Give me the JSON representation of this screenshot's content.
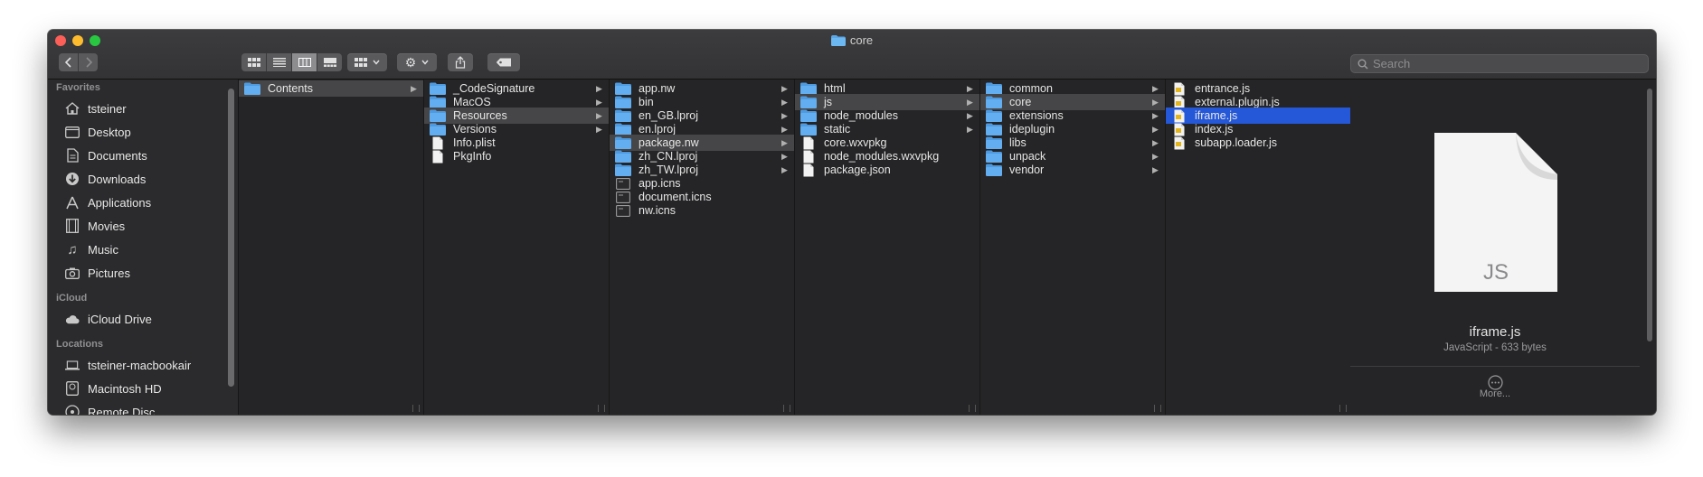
{
  "window": {
    "title": "core"
  },
  "search": {
    "placeholder": "Search"
  },
  "sidebar": {
    "favorites_header": "Favorites",
    "favorites": [
      "tsteiner",
      "Desktop",
      "Documents",
      "Downloads",
      "Applications",
      "Movies",
      "Music",
      "Pictures"
    ],
    "icloud_header": "iCloud",
    "icloud": [
      "iCloud Drive"
    ],
    "locations_header": "Locations",
    "locations": [
      "tsteiner-macbookair",
      "Macintosh HD",
      "Remote Disc"
    ]
  },
  "columns": [
    {
      "rows": [
        {
          "name": "Contents",
          "type": "folder",
          "arrow": true,
          "sel": "inactive"
        }
      ]
    },
    {
      "rows": [
        {
          "name": "_CodeSignature",
          "type": "folder",
          "arrow": true
        },
        {
          "name": "MacOS",
          "type": "folder",
          "arrow": true
        },
        {
          "name": "Resources",
          "type": "folder",
          "arrow": true,
          "sel": "inactive"
        },
        {
          "name": "Versions",
          "type": "folder",
          "arrow": true
        },
        {
          "name": "Info.plist",
          "type": "doc"
        },
        {
          "name": "PkgInfo",
          "type": "doc"
        }
      ]
    },
    {
      "rows": [
        {
          "name": "app.nw",
          "type": "folder",
          "arrow": true
        },
        {
          "name": "bin",
          "type": "folder",
          "arrow": true
        },
        {
          "name": "en_GB.lproj",
          "type": "folder",
          "arrow": true
        },
        {
          "name": "en.lproj",
          "type": "folder",
          "arrow": true
        },
        {
          "name": "package.nw",
          "type": "folder",
          "arrow": true,
          "sel": "inactive"
        },
        {
          "name": "zh_CN.lproj",
          "type": "folder",
          "arrow": true
        },
        {
          "name": "zh_TW.lproj",
          "type": "folder",
          "arrow": true
        },
        {
          "name": "app.icns",
          "type": "icns"
        },
        {
          "name": "document.icns",
          "type": "icns"
        },
        {
          "name": "nw.icns",
          "type": "icns"
        }
      ]
    },
    {
      "rows": [
        {
          "name": "html",
          "type": "folder",
          "arrow": true
        },
        {
          "name": "js",
          "type": "folder",
          "arrow": true,
          "sel": "inactive"
        },
        {
          "name": "node_modules",
          "type": "folder",
          "arrow": true
        },
        {
          "name": "static",
          "type": "folder",
          "arrow": true
        },
        {
          "name": "core.wxvpkg",
          "type": "doc"
        },
        {
          "name": "node_modules.wxvpkg",
          "type": "doc"
        },
        {
          "name": "package.json",
          "type": "doc"
        }
      ]
    },
    {
      "rows": [
        {
          "name": "common",
          "type": "folder",
          "arrow": true
        },
        {
          "name": "core",
          "type": "folder",
          "arrow": true,
          "sel": "inactive"
        },
        {
          "name": "extensions",
          "type": "folder",
          "arrow": true
        },
        {
          "name": "ideplugin",
          "type": "folder",
          "arrow": true
        },
        {
          "name": "libs",
          "type": "folder",
          "arrow": true
        },
        {
          "name": "unpack",
          "type": "folder",
          "arrow": true
        },
        {
          "name": "vendor",
          "type": "folder",
          "arrow": true
        }
      ]
    },
    {
      "rows": [
        {
          "name": "entrance.js",
          "type": "js"
        },
        {
          "name": "external.plugin.js",
          "type": "js"
        },
        {
          "name": "iframe.js",
          "type": "js",
          "sel": "active"
        },
        {
          "name": "index.js",
          "type": "js"
        },
        {
          "name": "subapp.loader.js",
          "type": "js"
        }
      ]
    }
  ],
  "preview": {
    "icon_label": "JS",
    "filename": "iframe.js",
    "meta": "JavaScript - 633 bytes",
    "more": "More..."
  }
}
